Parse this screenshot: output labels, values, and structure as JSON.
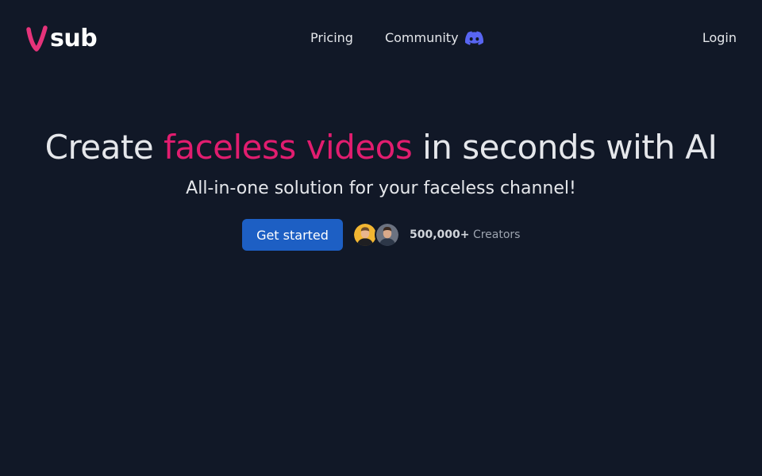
{
  "brand": {
    "logo_letter_icon": "v-logo-icon",
    "name": "sub",
    "accent_color": "#e6337a"
  },
  "nav": {
    "links": [
      {
        "label": "Pricing"
      },
      {
        "label": "Community",
        "icon": "discord-icon"
      }
    ],
    "login_label": "Login"
  },
  "hero": {
    "title_pre": "Create",
    "title_accent": "faceless videos",
    "title_post": "in seconds with AI",
    "subtitle": "All-in-one solution for your faceless channel!",
    "cta_label": "Get started",
    "creators_count": "500,000+",
    "creators_label": "Creators"
  },
  "colors": {
    "background": "#111827",
    "accent": "#e11d6f",
    "cta": "#1d5fc4",
    "discord": "#5865f2"
  }
}
